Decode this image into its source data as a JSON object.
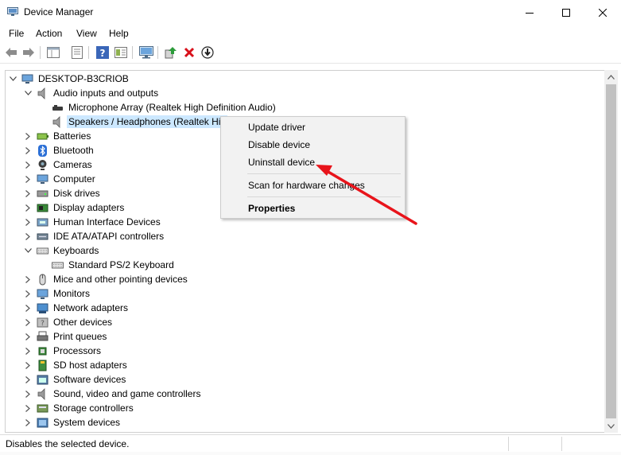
{
  "window": {
    "title": "Device Manager",
    "icon": "device-manager-icon"
  },
  "window_controls": [
    "minimize-icon",
    "maximize-icon",
    "close-icon"
  ],
  "menu": [
    "File",
    "Action",
    "View",
    "Help"
  ],
  "toolbar": [
    "back-arrow-icon",
    "forward-arrow-icon",
    "show-hide-icon",
    "properties-icon",
    "help-icon",
    "view-icon",
    "monitor-icon",
    "update-driver-icon",
    "uninstall-x-icon",
    "download-icon"
  ],
  "tree": {
    "root": "DESKTOP-B3CRIOB",
    "audio": {
      "label": "Audio inputs and outputs",
      "children": [
        "Microphone Array (Realtek High Definition Audio)",
        "Speakers / Headphones (Realtek Hig"
      ]
    },
    "categories_a": [
      "Batteries",
      "Bluetooth",
      "Cameras",
      "Computer",
      "Disk drives",
      "Display adapters",
      "Human Interface Devices",
      "IDE ATA/ATAPI controllers"
    ],
    "keyboards": {
      "label": "Keyboards",
      "children": [
        "Standard PS/2 Keyboard"
      ]
    },
    "categories_b": [
      "Mice and other pointing devices",
      "Monitors",
      "Network adapters",
      "Other devices",
      "Print queues",
      "Processors",
      "SD host adapters",
      "Software devices",
      "Sound, video and game controllers",
      "Storage controllers",
      "System devices"
    ]
  },
  "context_menu": {
    "update": "Update driver",
    "disable": "Disable device",
    "uninstall": "Uninstall device",
    "scan": "Scan for hardware changes",
    "properties": "Properties"
  },
  "annotation_color": "#e8141b",
  "selection_color": "#cce8ff",
  "status": "Disables the selected device."
}
